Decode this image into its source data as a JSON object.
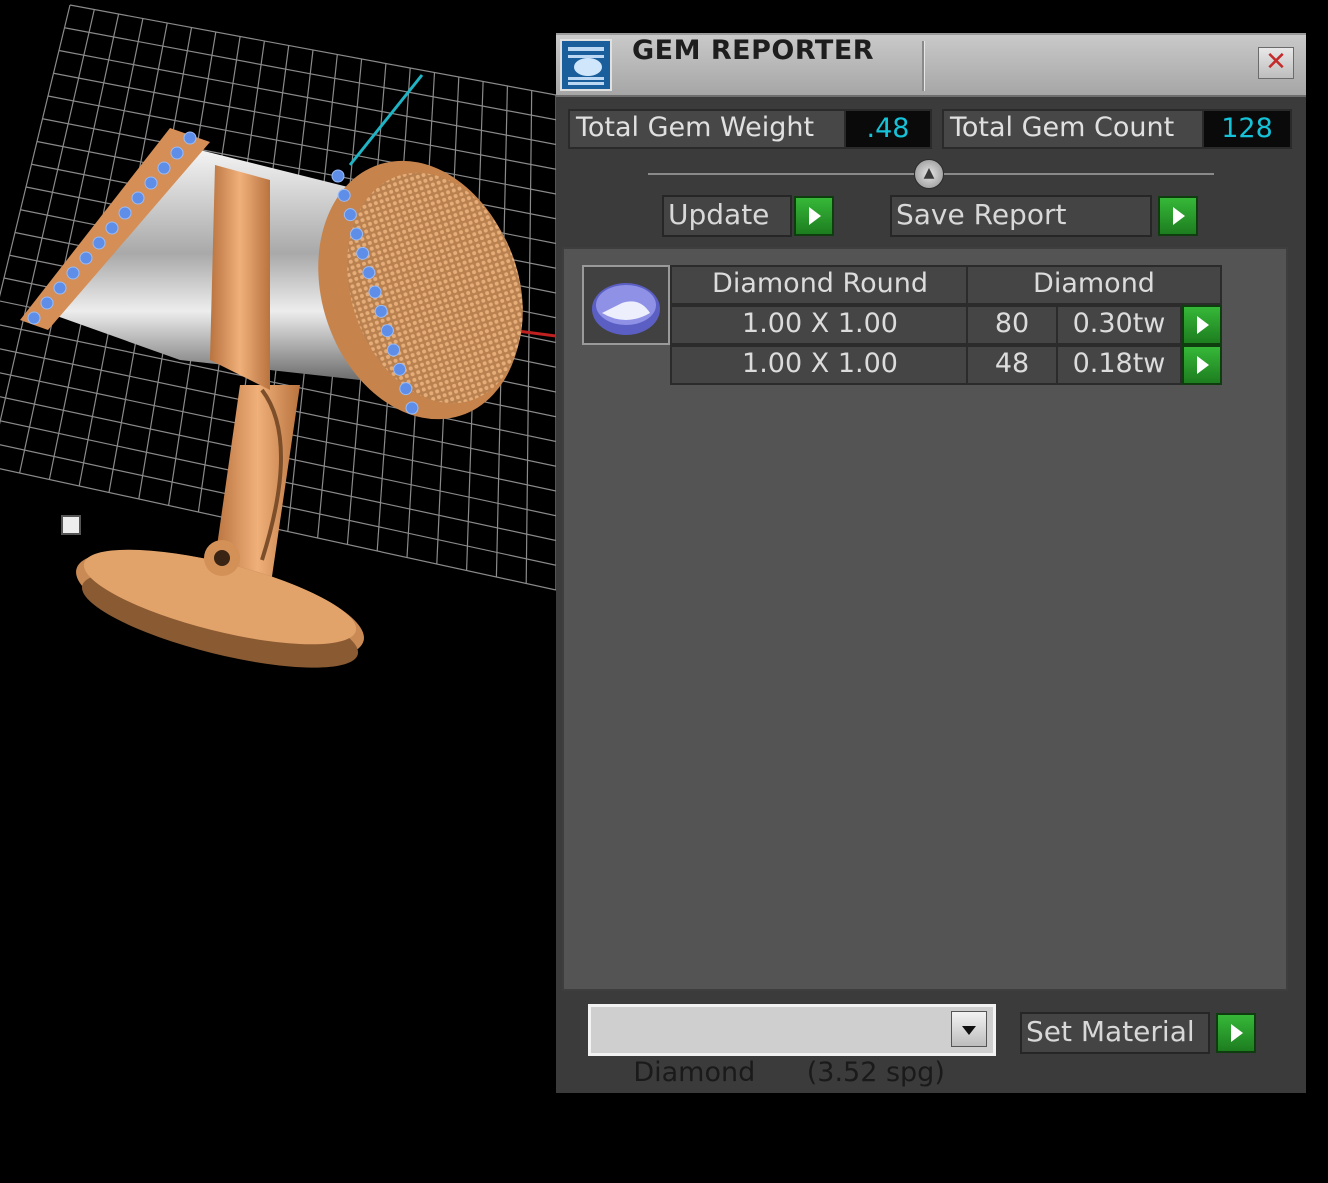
{
  "window": {
    "title": "GEM REPORTER",
    "close_glyph": "✕"
  },
  "summary": {
    "weight_label": "Total Gem Weight",
    "weight_value": ".48",
    "count_label": "Total Gem Count",
    "count_value": "128"
  },
  "actions": {
    "update_label": "Update",
    "save_label": "Save Report"
  },
  "report": {
    "gem_icon": "round-gem-icon",
    "header": {
      "shape": "Diamond Round",
      "material": "Diamond"
    },
    "rows": [
      {
        "size": "1.00 X 1.00",
        "count": "80",
        "weight": "0.30tw"
      },
      {
        "size": "1.00 X 1.00",
        "count": "48",
        "weight": "0.18tw"
      }
    ]
  },
  "material": {
    "selected": "Diamond      (3.52 spg)",
    "set_label": "Set Material"
  },
  "colors": {
    "value_text": "#16c2d8",
    "go_button": "#2a9e2c",
    "gold": "#d9955e",
    "gem_blue": "#5f8ee8"
  }
}
